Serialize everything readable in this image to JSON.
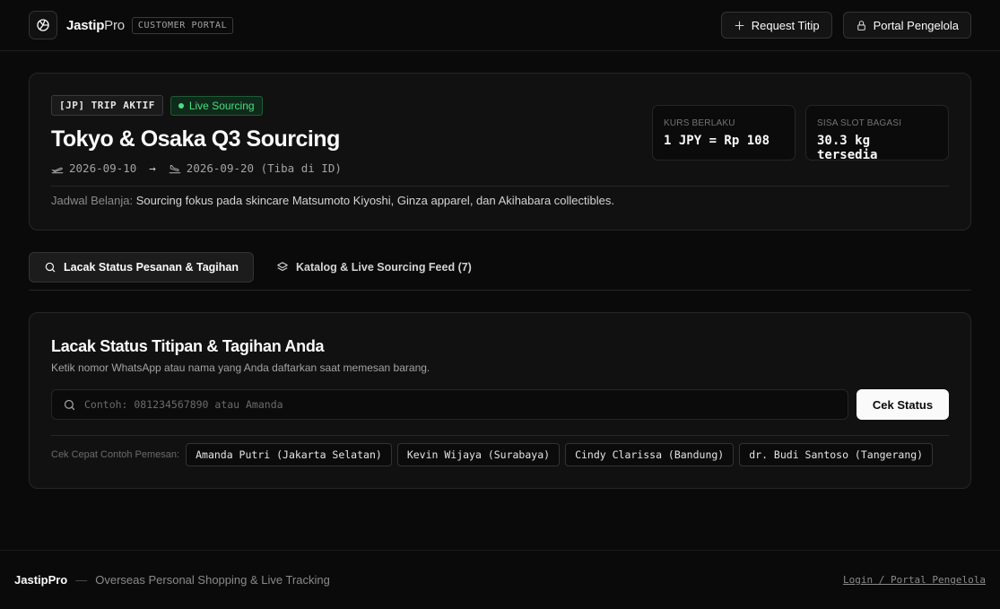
{
  "header": {
    "brand_main": "Jastip",
    "brand_suffix": "Pro",
    "portal_tag": "CUSTOMER PORTAL",
    "request_button": "Request Titip",
    "manager_button": "Portal Pengelola"
  },
  "trip": {
    "badge_trip": "[JP] TRIP AKTIF",
    "badge_live": "Live Sourcing",
    "title": "Tokyo & Osaka Q3 Sourcing",
    "departure": "2026-09-10",
    "arrow": "→",
    "arrival": "2026-09-20 (Tiba di ID)",
    "rate_label": "KURS BERLAKU",
    "rate_value": "1 JPY = Rp 108",
    "slot_label": "SISA SLOT BAGASI",
    "slot_value": "30.3 kg tersedia",
    "schedule_label": "Jadwal Belanja:",
    "schedule_text": "Sourcing fokus pada skincare Matsumoto Kiyoshi, Ginza apparel, dan Akihabara collectibles."
  },
  "tabs": [
    {
      "label": "Lacak Status Pesanan & Tagihan",
      "active": true
    },
    {
      "label": "Katalog & Live Sourcing Feed (7)",
      "active": false
    }
  ],
  "tracking": {
    "title": "Lacak Status Titipan & Tagihan Anda",
    "subtitle": "Ketik nomor WhatsApp atau nama yang Anda daftarkan saat memesan barang.",
    "search_placeholder": "Contoh: 081234567890 atau Amanda",
    "search_value": "",
    "check_button": "Cek Status",
    "quick_label": "Cek Cepat Contoh Pemesan:",
    "quick_examples": [
      "Amanda Putri (Jakarta Selatan)",
      "Kevin Wijaya (Surabaya)",
      "Cindy Clarissa (Bandung)",
      "dr. Budi Santoso (Tangerang)"
    ]
  },
  "footer": {
    "brand": "JastipPro",
    "separator": "—",
    "tagline": "Overseas Personal Shopping & Live Tracking",
    "login_link": "Login / Portal Pengelola"
  },
  "colors": {
    "background": "#0a0a0a",
    "card": "#111111",
    "live_green": "#4ade80",
    "primary_button": "#fafafa"
  }
}
